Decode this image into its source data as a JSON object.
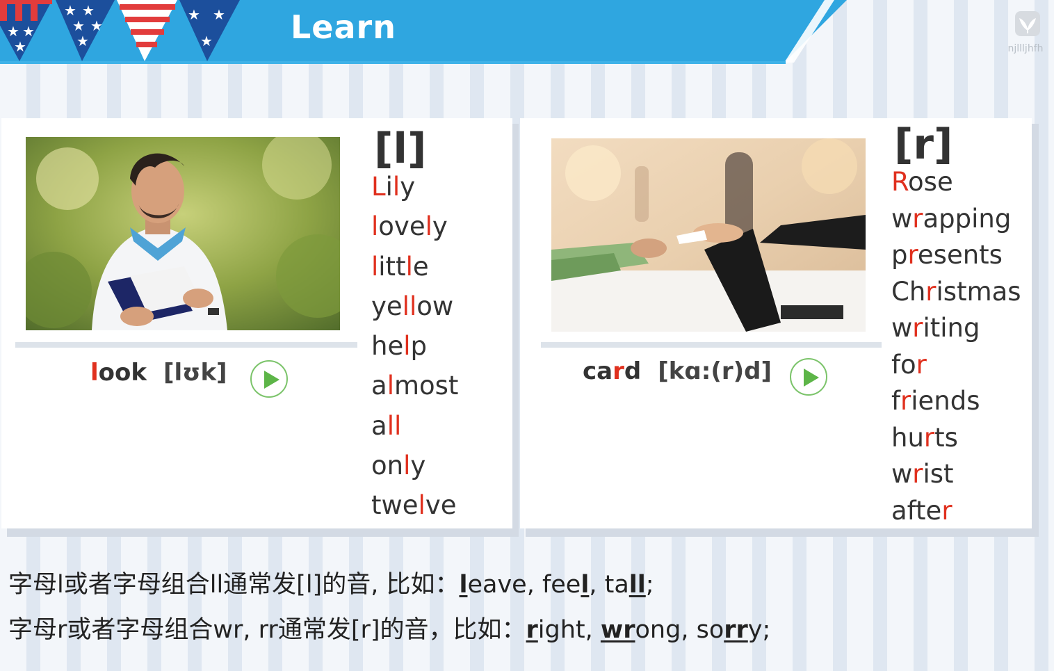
{
  "header": {
    "title": "Learn",
    "logo_text": "njllljhfh"
  },
  "colors": {
    "header_blue": "#2fa6e0",
    "highlight_red": "#e0301e",
    "play_green": "#5db548"
  },
  "left_card": {
    "phoneme": "[l]",
    "keyword": {
      "pre": "",
      "hl": "l",
      "post": "ook",
      "ipa": "[lʊk]"
    },
    "photo_icon": "man-reading-book-photo",
    "play_icon": "play-icon",
    "words": [
      {
        "parts": [
          {
            "t": "L",
            "r": true
          },
          {
            "t": "i",
            "r": false
          },
          {
            "t": "l",
            "r": true
          },
          {
            "t": "y",
            "r": false
          }
        ]
      },
      {
        "parts": [
          {
            "t": "l",
            "r": true
          },
          {
            "t": "ove",
            "r": false
          },
          {
            "t": "l",
            "r": true
          },
          {
            "t": "y",
            "r": false
          }
        ]
      },
      {
        "parts": [
          {
            "t": "l",
            "r": true
          },
          {
            "t": "itt",
            "r": false
          },
          {
            "t": "l",
            "r": true
          },
          {
            "t": "e",
            "r": false
          }
        ]
      },
      {
        "parts": [
          {
            "t": "ye",
            "r": false
          },
          {
            "t": "ll",
            "r": true
          },
          {
            "t": "ow",
            "r": false
          }
        ]
      },
      {
        "parts": [
          {
            "t": "he",
            "r": false
          },
          {
            "t": "l",
            "r": true
          },
          {
            "t": "p",
            "r": false
          }
        ]
      },
      {
        "parts": [
          {
            "t": "a",
            "r": false
          },
          {
            "t": "l",
            "r": true
          },
          {
            "t": "most",
            "r": false
          }
        ]
      },
      {
        "parts": [
          {
            "t": "a",
            "r": false
          },
          {
            "t": "ll",
            "r": true
          }
        ]
      },
      {
        "parts": [
          {
            "t": "on",
            "r": false
          },
          {
            "t": "l",
            "r": true
          },
          {
            "t": "y",
            "r": false
          }
        ]
      },
      {
        "parts": [
          {
            "t": "twe",
            "r": false
          },
          {
            "t": "l",
            "r": true
          },
          {
            "t": "ve",
            "r": false
          }
        ]
      }
    ]
  },
  "right_card": {
    "phoneme": "[r]",
    "keyword": {
      "pre": "ca",
      "hl": "r",
      "post": "d",
      "ipa": "[kɑ:(r)d]"
    },
    "photo_icon": "card-handover-photo",
    "play_icon": "play-icon",
    "words": [
      {
        "parts": [
          {
            "t": "R",
            "r": true
          },
          {
            "t": "ose",
            "r": false
          }
        ]
      },
      {
        "parts": [
          {
            "t": "w",
            "r": false
          },
          {
            "t": "r",
            "r": true
          },
          {
            "t": "apping",
            "r": false
          }
        ]
      },
      {
        "parts": [
          {
            "t": "p",
            "r": false
          },
          {
            "t": "r",
            "r": true
          },
          {
            "t": "esents",
            "r": false
          }
        ]
      },
      {
        "parts": [
          {
            "t": "Ch",
            "r": false
          },
          {
            "t": "r",
            "r": true
          },
          {
            "t": "istmas",
            "r": false
          }
        ]
      },
      {
        "parts": [
          {
            "t": "w",
            "r": false
          },
          {
            "t": "r",
            "r": true
          },
          {
            "t": "iting",
            "r": false
          }
        ]
      },
      {
        "parts": [
          {
            "t": "fo",
            "r": false
          },
          {
            "t": "r",
            "r": true
          }
        ]
      },
      {
        "parts": [
          {
            "t": "f",
            "r": false
          },
          {
            "t": "r",
            "r": true
          },
          {
            "t": "iends",
            "r": false
          }
        ]
      },
      {
        "parts": [
          {
            "t": "hu",
            "r": false
          },
          {
            "t": "r",
            "r": true
          },
          {
            "t": "ts",
            "r": false
          }
        ]
      },
      {
        "parts": [
          {
            "t": "w",
            "r": false
          },
          {
            "t": "r",
            "r": true
          },
          {
            "t": "ist",
            "r": false
          }
        ]
      },
      {
        "parts": [
          {
            "t": "afte",
            "r": false
          },
          {
            "t": "r",
            "r": true
          }
        ]
      }
    ]
  },
  "rules": [
    {
      "prefix": "字母l或者字母组合ll通常发[l]的音, 比如：",
      "examples": [
        {
          "parts": [
            {
              "t": "l",
              "u": true
            },
            {
              "t": "eave, fee",
              "u": false
            },
            {
              "t": "l",
              "u": true
            },
            {
              "t": ", ta",
              "u": false
            },
            {
              "t": "ll",
              "u": true
            },
            {
              "t": ";",
              "u": false
            }
          ]
        }
      ]
    },
    {
      "prefix": "字母r或者字母组合wr, rr通常发[r]的音，比如：",
      "examples": [
        {
          "parts": [
            {
              "t": "r",
              "u": true
            },
            {
              "t": "ight, ",
              "u": false
            },
            {
              "t": "wr",
              "u": true
            },
            {
              "t": "ong, so",
              "u": false
            },
            {
              "t": "rr",
              "u": true
            },
            {
              "t": "y;",
              "u": false
            }
          ]
        }
      ]
    }
  ]
}
